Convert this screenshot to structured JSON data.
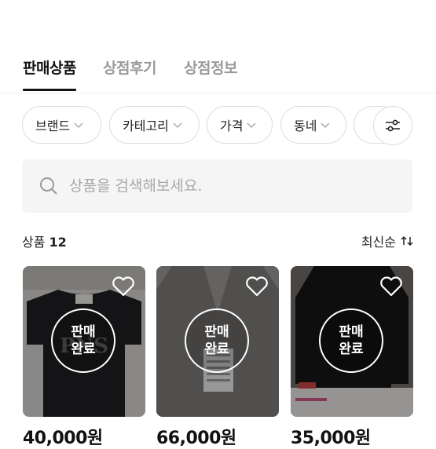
{
  "tabs": [
    {
      "label": "판매상품",
      "active": true
    },
    {
      "label": "상점후기",
      "active": false
    },
    {
      "label": "상점정보",
      "active": false
    }
  ],
  "filters": [
    {
      "label": "브랜드"
    },
    {
      "label": "카테고리"
    },
    {
      "label": "가격"
    },
    {
      "label": "동네"
    }
  ],
  "search": {
    "placeholder": "상품을 검색해보세요."
  },
  "list": {
    "count_label": "상품",
    "count_value": "12",
    "sort_label": "최신순"
  },
  "products": [
    {
      "status_line1": "판매",
      "status_line2": "완료",
      "price": "40,000원"
    },
    {
      "status_line1": "판매",
      "status_line2": "완료",
      "price": "66,000원"
    },
    {
      "status_line1": "판매",
      "status_line2": "완료",
      "price": "35,000원"
    }
  ],
  "colors": {
    "accent": "#111111",
    "muted": "#9a9a9a",
    "chip_border": "#dcdcdc",
    "search_bg": "#f5f5f5"
  }
}
